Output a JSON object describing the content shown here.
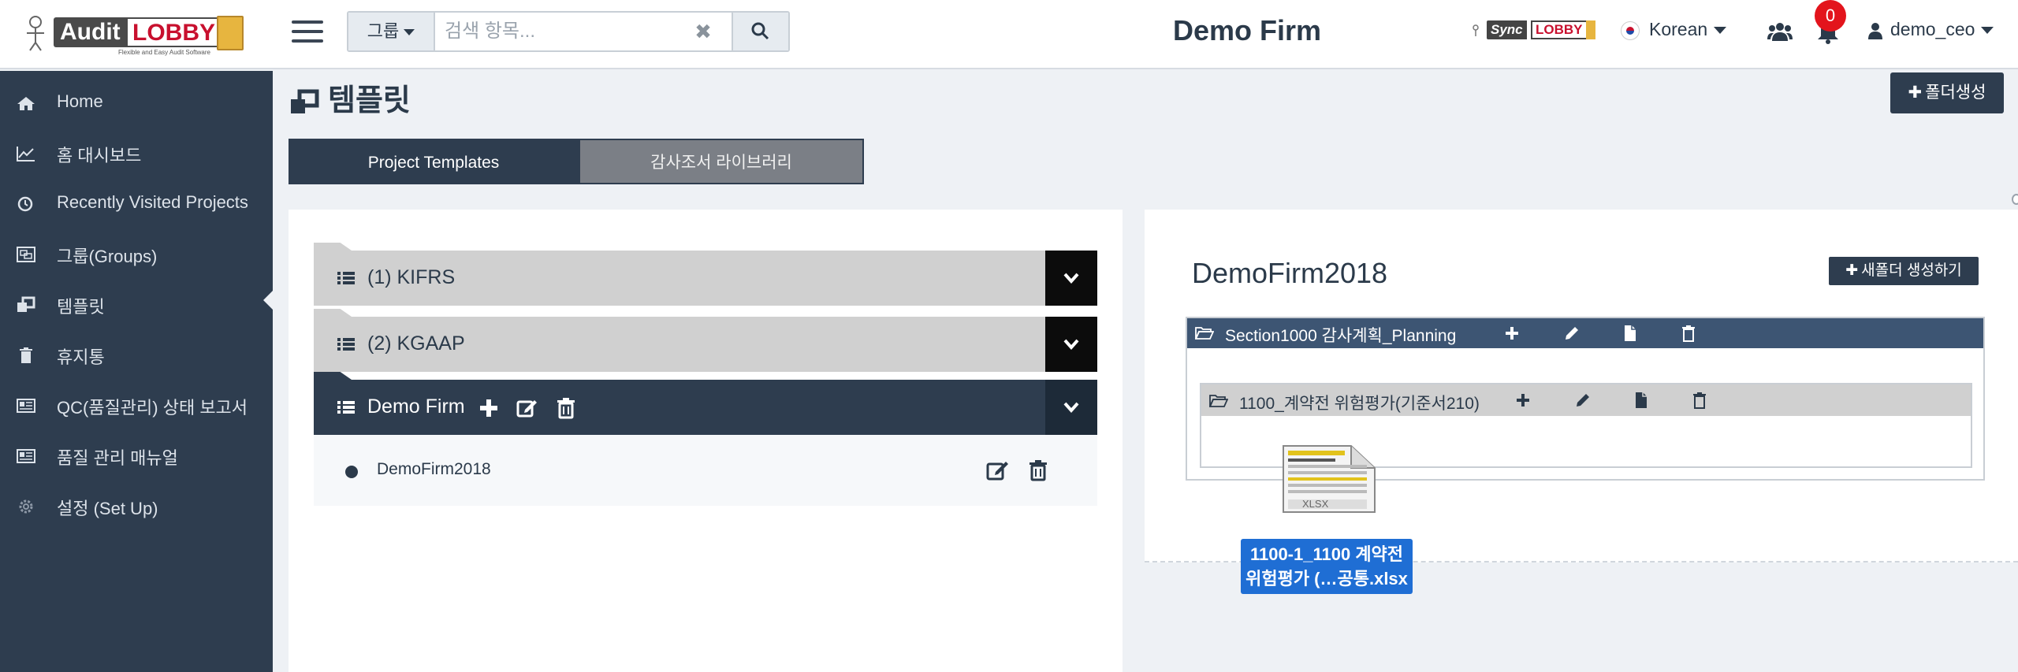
{
  "header": {
    "logo": {
      "word1": "Audit",
      "word2": "LOBBY",
      "tagline": "Flexible and Easy Audit Software"
    },
    "search": {
      "group_label": "그룹",
      "placeholder": "검색 항목..."
    },
    "firm_name": "Demo Firm",
    "sync_logo": {
      "word1": "Sync",
      "word2": "LOBBY"
    },
    "language": "Korean",
    "notification_count": "0",
    "username": "demo_ceo"
  },
  "sidebar": {
    "items": [
      {
        "label": "Home",
        "icon": "home-icon"
      },
      {
        "label": "홈 대시보드",
        "icon": "line-chart-icon"
      },
      {
        "label": "Recently Visited Projects",
        "icon": "clock-icon"
      },
      {
        "label": "그룹(Groups)",
        "icon": "object-group-icon"
      },
      {
        "label": "템플릿",
        "icon": "clone-icon",
        "active": true
      },
      {
        "label": "휴지통",
        "icon": "trash-icon"
      },
      {
        "label": "QC(품질관리) 상태 보고서",
        "icon": "newspaper-icon"
      },
      {
        "label": "품질 관리 매뉴얼",
        "icon": "newspaper-icon"
      },
      {
        "label": "설정 (Set Up)",
        "icon": "gear-icon"
      }
    ]
  },
  "main": {
    "title": "템플릿",
    "create_folder_label": "폴더생성",
    "tabs": [
      {
        "label": "Project Templates",
        "active": true
      },
      {
        "label": "감사조서 라이브러리",
        "active": false
      }
    ],
    "template_groups": [
      {
        "name": "(1) KIFRS",
        "expanded": false
      },
      {
        "name": "(2) KGAAP",
        "expanded": false
      },
      {
        "name": "Demo Firm",
        "expanded": true
      }
    ],
    "templates": [
      {
        "name": "DemoFirm2018"
      }
    ]
  },
  "detail": {
    "title": "DemoFirm2018",
    "new_folder_label": "새폴더 생성하기",
    "section": {
      "name": "Section1000 감사계획_Planning"
    },
    "subfolder": {
      "name": "1100_계약전 위험평가(기준서210)"
    },
    "dragged_file": {
      "label": "1100-1_1100 계약전 위험평가 (…공통.xlsx",
      "icon_text": "XLSX"
    }
  },
  "colors": {
    "sidebar_bg": "#2e3d4f",
    "accent_dark": "#2e3d4f",
    "section_header": "#3d5573",
    "badge": "#e3141c",
    "drag_label": "#1f6ed4"
  }
}
